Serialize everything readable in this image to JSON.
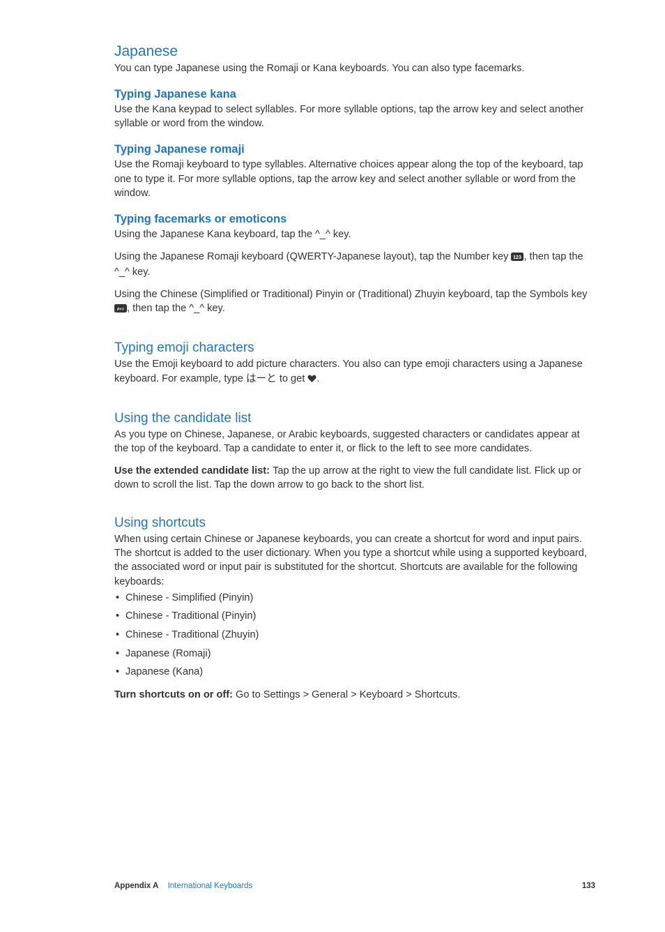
{
  "sections": {
    "japanese": {
      "title": "Japanese",
      "intro": "You can type Japanese using the Romaji or Kana keyboards. You can also type facemarks.",
      "kana": {
        "title": "Typing Japanese kana",
        "body": "Use the Kana keypad to select syllables. For more syllable options, tap the arrow key and select another syllable or word from the window."
      },
      "romaji": {
        "title": "Typing Japanese romaji",
        "body": "Use the Romaji keyboard to type syllables. Alternative choices appear along the top of the keyboard, tap one to type it. For more syllable options, tap the arrow key and select another syllable or word from the window."
      },
      "facemarks": {
        "title": "Typing facemarks or emoticons",
        "p1": "Using the Japanese Kana keyboard, tap the ^_^ key.",
        "p2a": "Using the Japanese Romaji keyboard (QWERTY-Japanese layout), tap the Number key ",
        "p2b": ", then tap the ^_^ key.",
        "p3a": "Using the Chinese (Simplified or Traditional) Pinyin or (Traditional) Zhuyin keyboard, tap the Symbols key ",
        "p3b": ", then tap the ^_^ key."
      }
    },
    "emoji": {
      "title": "Typing emoji characters",
      "p1a": "Use the Emoji keyboard to add picture characters. You also can type emoji characters using a Japanese keyboard. For example, type はーと to get ",
      "p1b": "."
    },
    "candidate": {
      "title": "Using the candidate list",
      "p1": "As you type on Chinese, Japanese, or Arabic keyboards, suggested characters or candidates appear at the top of the keyboard. Tap a candidate to enter it, or flick to the left to see more candidates.",
      "p2lead": "Use the extended candidate list:  ",
      "p2rest": "Tap the up arrow at the right to view the full candidate list. Flick up or down to scroll the list. Tap the down arrow to go back to the short list."
    },
    "shortcuts": {
      "title": "Using shortcuts",
      "p1": "When using certain Chinese or Japanese keyboards, you can create a shortcut for word and input pairs. The shortcut is added to the user dictionary. When you type a shortcut while using a supported keyboard, the associated word or input pair is substituted for the shortcut. Shortcuts are available for the following keyboards:",
      "items": [
        "Chinese - Simplified (Pinyin)",
        "Chinese - Traditional (Pinyin)",
        "Chinese - Traditional (Zhuyin)",
        "Japanese (Romaji)",
        "Japanese (Kana)"
      ],
      "p2lead": "Turn shortcuts on or off:  ",
      "p2rest": "Go to Settings > General > Keyboard > Shortcuts."
    }
  },
  "footer": {
    "appendix": "Appendix A",
    "chapter": "International Keyboards",
    "page": "133"
  }
}
